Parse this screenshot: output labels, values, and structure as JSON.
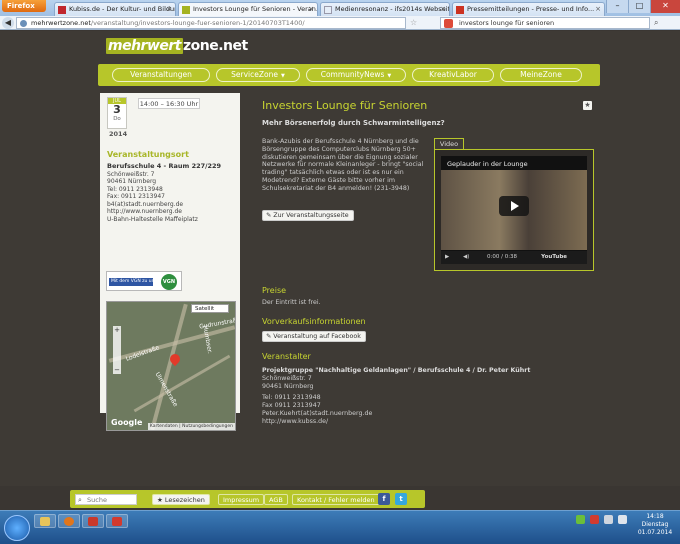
{
  "browser": {
    "app_button": "Firefox",
    "tabs": [
      {
        "label": "Kubiss.de - Der Kultur- und Bildungss...",
        "active": false
      },
      {
        "label": "Investors Lounge für Senioren - Veran...",
        "active": true
      },
      {
        "label": "Medienresonanz - ifs2014s Webseite!",
        "active": false
      },
      {
        "label": "Pressemitteilungen - Presse- und Info...",
        "active": false
      }
    ],
    "new_tab": "+",
    "url_domain": "mehrwertzone.net",
    "url_path": "/veranstaltung/investors-lounge-fuer-senioren-1/20140703T1400/",
    "search_text": "investors lounge für senioren"
  },
  "site": {
    "logo_left": "mehrwert",
    "logo_right": "zone.net",
    "menu": [
      {
        "label": "Veranstaltungen",
        "dropdown": false
      },
      {
        "label": "ServiceZone",
        "dropdown": true
      },
      {
        "label": "CommunityNews",
        "dropdown": true
      },
      {
        "label": "KreativLabor",
        "dropdown": false
      },
      {
        "label": "MeineZone",
        "dropdown": false
      }
    ]
  },
  "event": {
    "month": "JUL",
    "day": "3",
    "weekday": "Do",
    "year": "2014",
    "time": "14:00 – 16:30 Uhr",
    "title": "Investors Lounge für Senioren",
    "subtitle": "Mehr Börsenerfolg durch Schwarmintelligenz?",
    "description": "Bank-Azubis der Berufsschule 4 Nürnberg und die Börsengruppe des Computerclubs Nürnberg 50+ diskutieren gemeinsam über die Eignung sozialer Netzwerke für normale Kleinanleger - bringt \"social trading\" tatsächlich etwas oder ist es nur ein Modetrend? Externe Gäste bitte vorher im Schulsekretariat der B4 anmelden! (231-3948)",
    "venue_button": "Zur Veranstaltungsseite"
  },
  "venue": {
    "heading": "Veranstaltungsort",
    "name": "Berufsschule 4 - Raum 227/229",
    "street": "Schönweißstr. 7",
    "city": "90461 Nürnberg",
    "tel": "Tel: 0911 2313948",
    "fax": "Fax: 0911 2313947",
    "email": "b4(at)stadt.nuernberg.de",
    "web": "http://www.nuernberg.de",
    "transit": "U-Bahn-Haltestelle Maffeiplatz",
    "vgn_bar": "Mit dem VGN zu uns",
    "vgn_logo": "VGN"
  },
  "map": {
    "type_select": "Satellit",
    "zoom_in": "+",
    "zoom_out": "−",
    "streets": [
      "Gudrunstraße",
      "Humbser.",
      "Lodelstraße",
      "Ulmenstraße"
    ],
    "brand": "Google",
    "attribution": "Kartendaten | Nutzungsbedingungen"
  },
  "video": {
    "tab": "Video",
    "title": "Geplauder in der Lounge",
    "time": "0:00 / 0:38",
    "brand": "YouTube"
  },
  "sections": {
    "preise_heading": "Preise",
    "preise_text": "Der Eintritt ist frei.",
    "vvk_heading": "Vorverkaufsinformationen",
    "fb_button": "Veranstaltung auf Facebook",
    "veranstalter_heading": "Veranstalter",
    "org_name": "Projektgruppe \"Nachhaltige Geldanlagen\" / Berufsschule 4 / Dr. Peter Kührt",
    "org_street": "Schönweißstr. 7",
    "org_city": "90461 Nürnberg",
    "org_tel": "Tel: 0911 2313948",
    "org_fax": "Fax 0911 2313947",
    "org_email": "Peter.Kuehrt(at)stadt.nuernberg.de",
    "org_web": "http://www.kubss.de/"
  },
  "footer": {
    "search_placeholder": "Suche",
    "bookmarks": "Lesezeichen",
    "links": [
      "Impressum",
      "AGB",
      "Kontakt / Fehler melden"
    ],
    "facebook": "f",
    "twitter": "t"
  },
  "taskbar": {
    "time": "14:18",
    "weekday": "Dienstag",
    "date": "01.07.2014"
  }
}
